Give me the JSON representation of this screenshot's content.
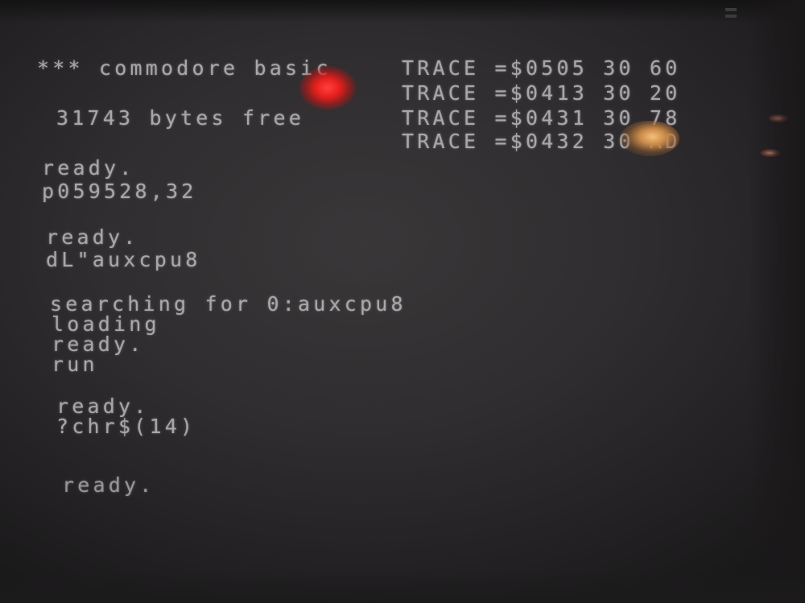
{
  "terminal": {
    "banner": "*** commodore basic",
    "bytes_free": "31743 bytes free",
    "trace_lines": [
      "TRACE =$0505 30 60",
      "TRACE =$0413 30 20",
      "TRACE =$0431 30 78",
      "TRACE =$0432 30 AD"
    ],
    "session_lines": [
      "ready.",
      "p059528,32",
      "ready.",
      "dL\"auxcpu8",
      "searching for 0:auxcpu8",
      "loading",
      "ready.",
      "run",
      "ready.",
      "?chr$(14)",
      "ready."
    ]
  }
}
